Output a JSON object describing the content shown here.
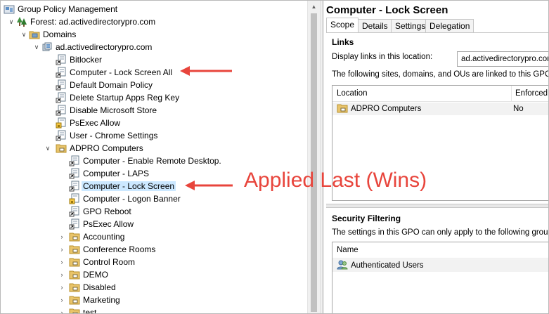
{
  "tree": {
    "root": "Group Policy Management",
    "forest": "Forest: ad.activedirectorypro.com",
    "domains": "Domains",
    "domain": "ad.activedirectorypro.com",
    "linked_gpos": [
      "Bitlocker",
      "Computer - Lock Screen All",
      "Default Domain Policy",
      "Delete Startup Apps Reg Key",
      "Disable Microsoft Store",
      "PsExec Allow",
      "User - Chrome Settings"
    ],
    "ou": "ADPRO Computers",
    "ou_gpos": [
      "Computer - Enable Remote Desktop.",
      "Computer - LAPS",
      "Computer - Lock Screen",
      "Computer - Logon Banner",
      "GPO Reboot",
      "PsExec Allow"
    ],
    "sub_ous": [
      "Accounting",
      "Conference Rooms",
      "Control Room",
      "DEMO",
      "Disabled",
      "Marketing",
      "test"
    ]
  },
  "detail": {
    "title": "Computer - Lock Screen",
    "tabs": [
      "Scope",
      "Details",
      "Settings",
      "Delegation"
    ],
    "links_heading": "Links",
    "display_links_label": "Display links in this location:",
    "display_links_value": "ad.activedirectorypro.com",
    "linked_text": "The following sites, domains, and OUs are linked to this GPO:",
    "links_columns": [
      "Location",
      "Enforced"
    ],
    "links_rows": [
      {
        "location": "ADPRO Computers",
        "enforced": "No"
      }
    ],
    "security_heading": "Security Filtering",
    "security_text": "The settings in this GPO can only apply to the following groups, us",
    "security_columns": [
      "Name"
    ],
    "security_rows": [
      "Authenticated Users"
    ]
  },
  "annotation": {
    "callout": "Applied Last (Wins)",
    "color": "#e8453c"
  }
}
